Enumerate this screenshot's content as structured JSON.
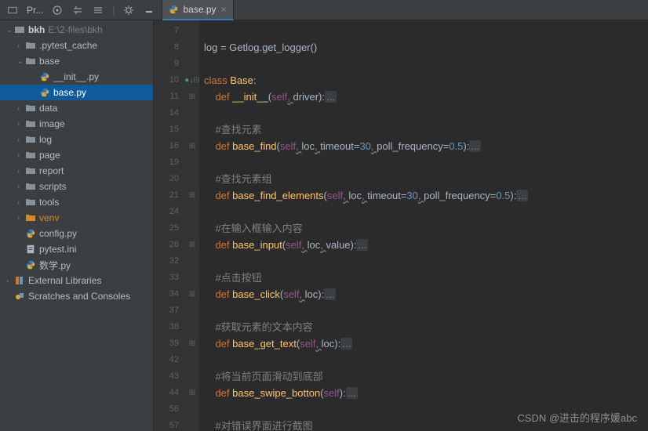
{
  "topbar": {
    "project_label": "Pr..."
  },
  "editor_tab": {
    "filename": "base.py"
  },
  "tree": {
    "root": {
      "name": "bkh",
      "path": "E:\\2-files\\bkh"
    },
    "items": [
      {
        "name": ".pytest_cache",
        "indent": 1,
        "kind": "dir",
        "arrow": "›"
      },
      {
        "name": "base",
        "indent": 1,
        "kind": "dir",
        "arrow": "⌄"
      },
      {
        "name": "__init__.py",
        "indent": 2,
        "kind": "py",
        "arrow": ""
      },
      {
        "name": "base.py",
        "indent": 2,
        "kind": "py",
        "arrow": "",
        "selected": true
      },
      {
        "name": "data",
        "indent": 1,
        "kind": "dir",
        "arrow": "›"
      },
      {
        "name": "image",
        "indent": 1,
        "kind": "dir",
        "arrow": "›"
      },
      {
        "name": "log",
        "indent": 1,
        "kind": "dir",
        "arrow": "›"
      },
      {
        "name": "page",
        "indent": 1,
        "kind": "dir",
        "arrow": "›"
      },
      {
        "name": "report",
        "indent": 1,
        "kind": "dir",
        "arrow": "›"
      },
      {
        "name": "scripts",
        "indent": 1,
        "kind": "dir",
        "arrow": "›"
      },
      {
        "name": "tools",
        "indent": 1,
        "kind": "dir",
        "arrow": "›"
      },
      {
        "name": "venv",
        "indent": 1,
        "kind": "venv",
        "arrow": "›"
      },
      {
        "name": "config.py",
        "indent": 1,
        "kind": "py",
        "arrow": ""
      },
      {
        "name": "pytest.ini",
        "indent": 1,
        "kind": "ini",
        "arrow": ""
      },
      {
        "name": "数学.py",
        "indent": 1,
        "kind": "py",
        "arrow": ""
      }
    ],
    "ext_libs": "External Libraries",
    "scratches": "Scratches and Consoles"
  },
  "code": {
    "lines": [
      {
        "n": 7,
        "t": ""
      },
      {
        "n": 8,
        "t": "log = Getlog.get_logger()"
      },
      {
        "n": 9,
        "t": ""
      },
      {
        "n": 10,
        "t": "class Base:",
        "fold": "⊟",
        "mark": "●↓"
      },
      {
        "n": 11,
        "t": "    def __init__(self, driver):...",
        "fold": "⊞"
      },
      {
        "n": 14,
        "t": ""
      },
      {
        "n": 15,
        "t": "    #查找元素"
      },
      {
        "n": 16,
        "t": "    def base_find(self, loc, timeout=30, poll_frequency=0.5):...",
        "fold": "⊞"
      },
      {
        "n": 19,
        "t": ""
      },
      {
        "n": 20,
        "t": "    #查找元素组"
      },
      {
        "n": 21,
        "t": "    def base_find_elements(self, loc, timeout=30, poll_frequency=0.5):...",
        "fold": "⊞"
      },
      {
        "n": 24,
        "t": ""
      },
      {
        "n": 25,
        "t": "    #在输入框输入内容"
      },
      {
        "n": 26,
        "t": "    def base_input(self, loc, value):...",
        "fold": "⊞"
      },
      {
        "n": 32,
        "t": ""
      },
      {
        "n": 33,
        "t": "    #点击按钮"
      },
      {
        "n": 34,
        "t": "    def base_click(self, loc):...",
        "fold": "⊞"
      },
      {
        "n": 37,
        "t": ""
      },
      {
        "n": 38,
        "t": "    #获取元素的文本内容"
      },
      {
        "n": 39,
        "t": "    def base_get_text(self, loc):...",
        "fold": "⊞"
      },
      {
        "n": 42,
        "t": ""
      },
      {
        "n": 43,
        "t": "    #将当前页面滑动到底部"
      },
      {
        "n": 44,
        "t": "    def base_swipe_botton(self):...",
        "fold": "⊞"
      },
      {
        "n": 56,
        "t": ""
      },
      {
        "n": 57,
        "t": "    #对错误界面进行截图"
      }
    ]
  },
  "watermark": "CSDN @进击的程序媛abc"
}
